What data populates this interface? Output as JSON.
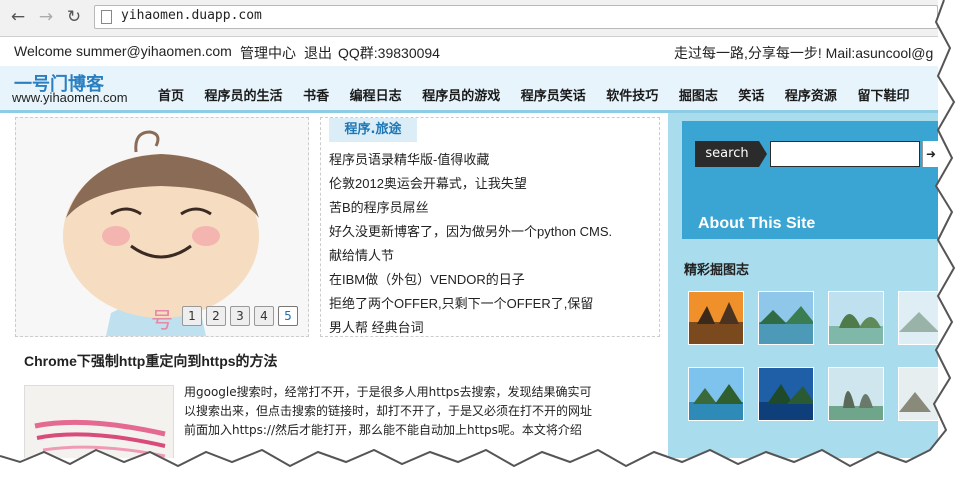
{
  "browser": {
    "url": "yihaomen.duapp.com"
  },
  "topbar": {
    "welcome": "Welcome summer@yihaomen.com",
    "admin": "管理中心",
    "logout": "退出",
    "qq": "QQ群:39830094",
    "slogan": "走过每一路,分享每一步! Mail:asuncool@g"
  },
  "header": {
    "logo_cn": "一号门博客",
    "logo_url": "www.yihaomen.com",
    "menu": [
      "首页",
      "程序员的生活",
      "书香",
      "编程日志",
      "程序员的游戏",
      "程序员笑话",
      "软件技巧",
      "掘图志",
      "笑话",
      "程序资源",
      "留下鞋印"
    ]
  },
  "slider": {
    "pages": [
      "1",
      "2",
      "3",
      "4",
      "5"
    ],
    "active": "5"
  },
  "posts": {
    "tab": "程序.旅途",
    "items": [
      "程序员语录精华版-值得收藏",
      "伦敦2012奥运会开幕式，让我失望",
      "苦B的程序员屌丝",
      "好久没更新博客了，因为做另外一个python CMS.",
      "献给情人节",
      "在IBM做（外包）VENDOR的日子",
      "拒绝了两个OFFER,只剩下一个OFFER了,保留",
      "男人帮 经典台词"
    ]
  },
  "article": {
    "title": "Chrome下强制http重定向到https的方法",
    "lines": [
      "用google搜索时，经常打不开，于是很多人用https去搜索，发现结果确实可",
      "以搜索出来，但点击搜索的链接时，却打不开了，于是又必须在打不开的网址",
      "前面加入https://然后才能打开，那么能不能自动加上https呢。本文将介绍"
    ]
  },
  "sidebar": {
    "search_label": "search",
    "about": "About This Site",
    "gallery_title": "精彩掘图志"
  },
  "colors": {
    "header_bg": "#e7f4fb",
    "logo_blue": "#2a7fc1",
    "sidebar_bg": "#a9dcec",
    "sidebar_top": "#3aa5d2"
  }
}
